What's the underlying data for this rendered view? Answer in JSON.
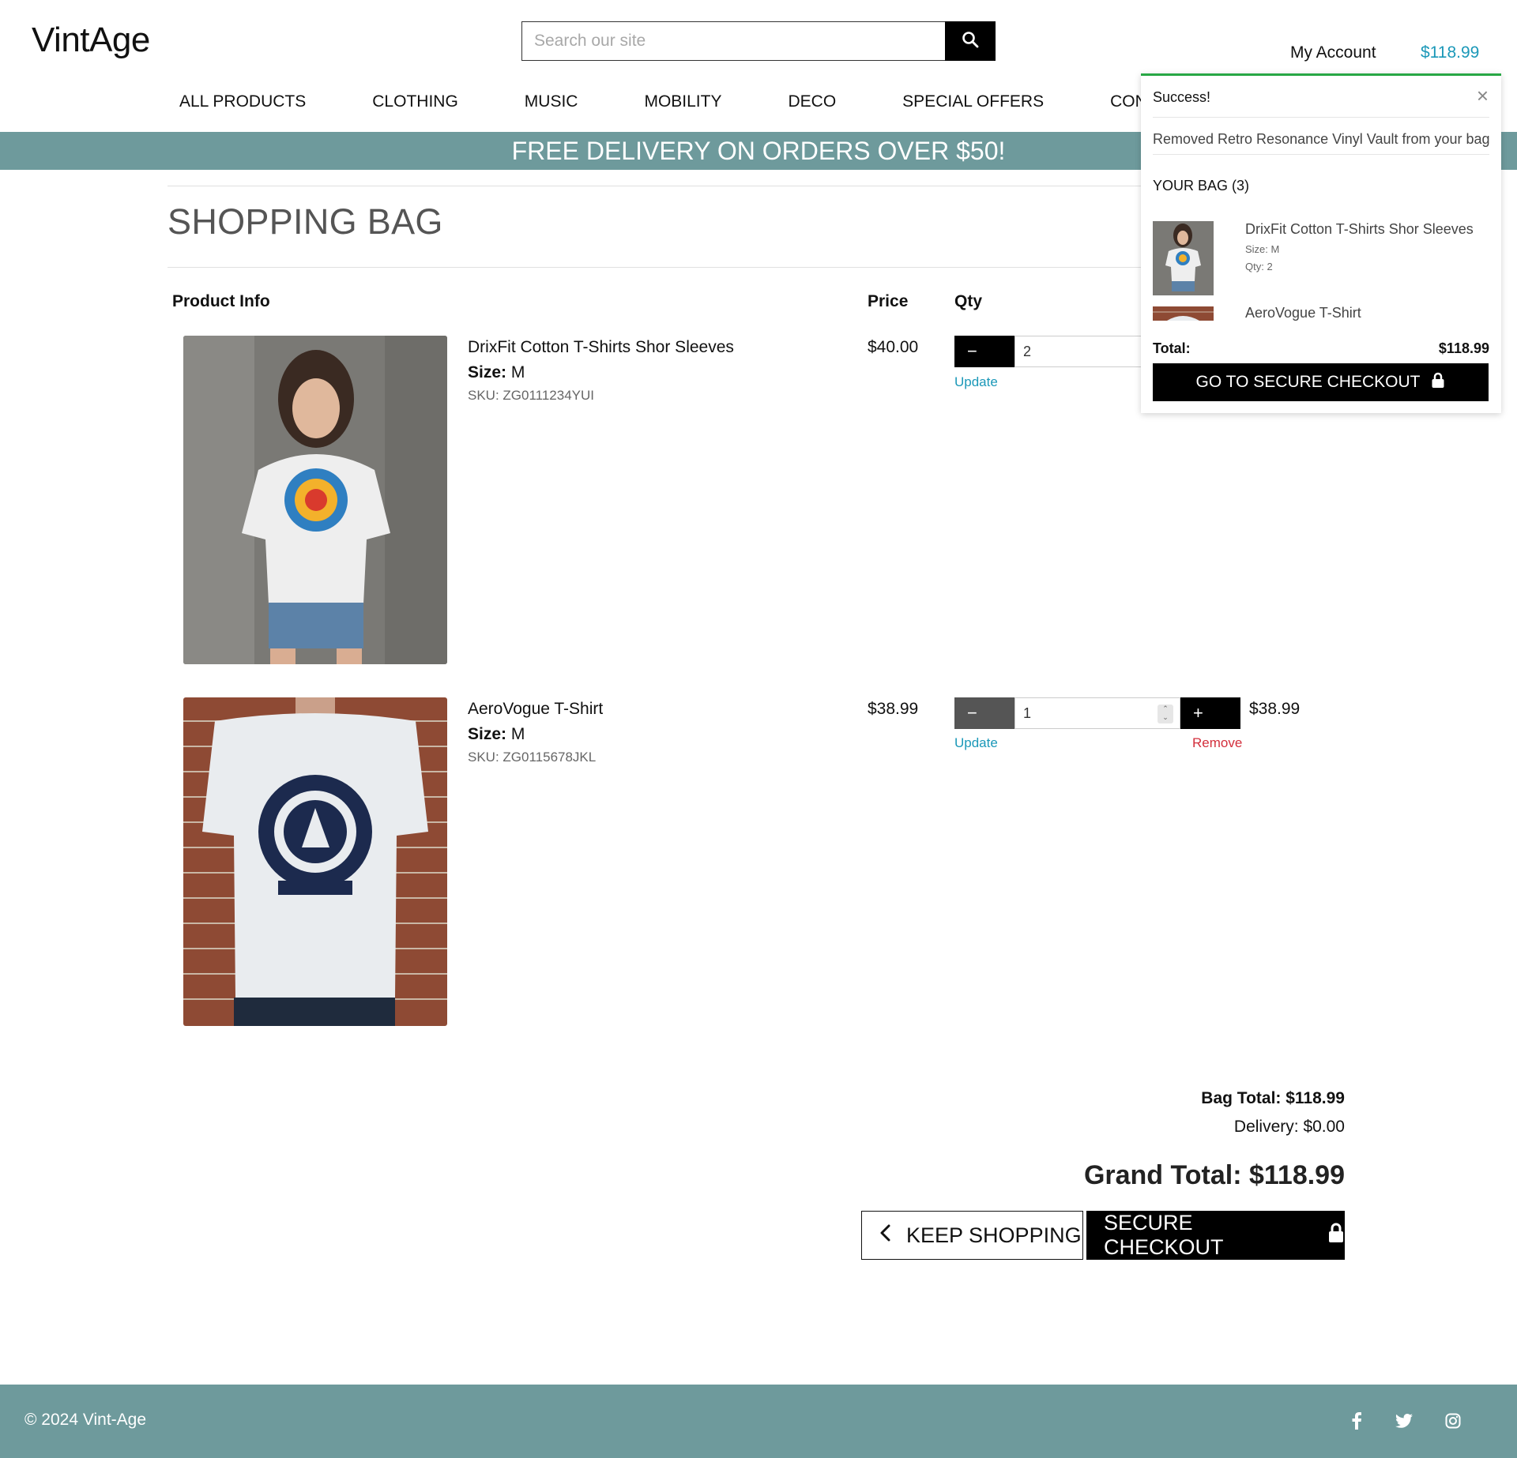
{
  "brand": {
    "logo": "VintAge"
  },
  "search": {
    "placeholder": "Search our site",
    "icon": "search-icon"
  },
  "header": {
    "account_label": "My Account",
    "cart_total": "$118.99"
  },
  "nav": {
    "items": [
      {
        "label": "ALL PRODUCTS"
      },
      {
        "label": "CLOTHING"
      },
      {
        "label": "MUSIC"
      },
      {
        "label": "MOBILITY"
      },
      {
        "label": "DECO"
      },
      {
        "label": "SPECIAL OFFERS"
      },
      {
        "label": "CONT"
      }
    ]
  },
  "banner": {
    "text": "FREE DELIVERY ON ORDERS OVER $50!"
  },
  "page": {
    "title": "SHOPPING BAG"
  },
  "table": {
    "headers": {
      "product": "Product Info",
      "price": "Price",
      "qty": "Qty"
    },
    "rows": [
      {
        "name": "DrixFit Cotton T-Shirts Shor Sleeves",
        "size_label": "Size:",
        "size": "M",
        "sku": "SKU: ZG0111234YUI",
        "price": "$40.00",
        "qty": "2",
        "minus": "−",
        "update": "Update"
      },
      {
        "name": "AeroVogue T-Shirt",
        "size_label": "Size:",
        "size": "M",
        "sku": "SKU: ZG0115678JKL",
        "price": "$38.99",
        "qty": "1",
        "minus": "−",
        "plus": "+",
        "update": "Update",
        "remove": "Remove",
        "line_total": "$38.99"
      }
    ]
  },
  "totals": {
    "bag_total": "Bag Total: $118.99",
    "delivery": "Delivery: $0.00",
    "grand_total": "Grand Total: $118.99"
  },
  "actions": {
    "keep_shopping": "KEEP SHOPPING",
    "secure_checkout": "SECURE CHECKOUT"
  },
  "footer": {
    "copyright": "© 2024 Vint-Age",
    "social": [
      "facebook-icon",
      "twitter-icon",
      "instagram-icon"
    ]
  },
  "popup": {
    "status": "Success!",
    "close": "×",
    "message": "Removed Retro Resonance Vinyl Vault from your bag",
    "bag_heading": "YOUR BAG (3)",
    "items": [
      {
        "name": "DrixFit Cotton T-Shirts Shor Sleeves",
        "size": "Size: M",
        "qty": "Qty: 2"
      },
      {
        "name": "AeroVogue T-Shirt"
      }
    ],
    "total_label": "Total:",
    "total_value": "$118.99",
    "checkout": "GO TO SECURE CHECKOUT"
  },
  "colors": {
    "accent": "#1b98b8",
    "banner": "#6e9a9c",
    "remove": "#d32f3c",
    "success": "#28a745"
  }
}
